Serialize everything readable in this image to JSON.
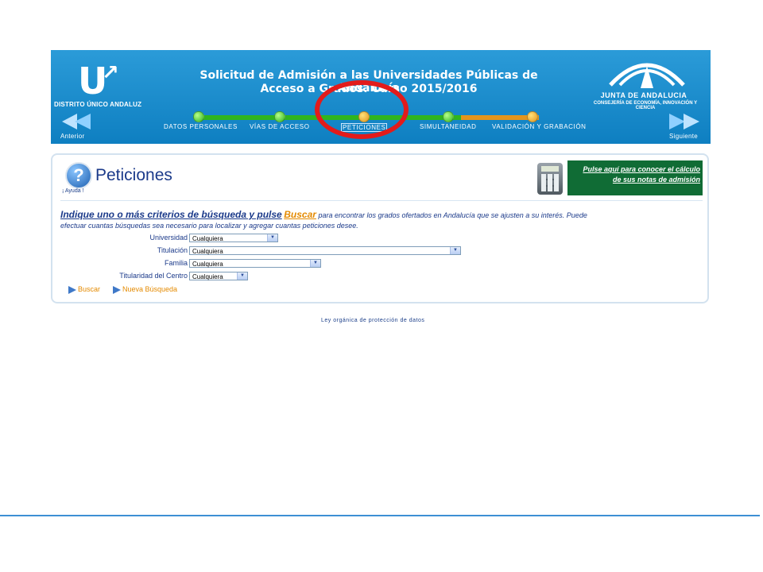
{
  "header": {
    "logo_text": "U",
    "district_label": "DISTRITO ÚNICO ANDALUZ",
    "title_line1": "Solicitud de Admisión a las Universidades Públicas de Andalucía",
    "title_line2": "Acceso a Grados. Curso 2015/2016",
    "junta_name": "JUNTA DE ANDALUCIA",
    "consejeria": "CONSEJERÍA DE ECONOMÍA, INNOVACIÓN Y CIENCIA",
    "prev_label": "Anterior",
    "next_label": "Siguiente",
    "steps": [
      {
        "label": "DATOS PERSONALES",
        "status": "done"
      },
      {
        "label": "VÍAS DE ACCESO",
        "status": "done"
      },
      {
        "label": "PETICIONES",
        "status": "current"
      },
      {
        "label": "SIMULTANEIDAD",
        "status": "done"
      },
      {
        "label": "VALIDACIÓN Y GRABACIÓN",
        "status": "pending"
      }
    ]
  },
  "colors": {
    "header_blue": "#0e7fc1",
    "step_green": "#2fb51e",
    "step_orange": "#e3951c",
    "highlight_red": "#e21b1b",
    "link_orange": "#e48a00",
    "text_blue": "#1b3a8a",
    "grade_box_green": "#106c35"
  },
  "panel": {
    "help_label": "¡ Ayuda !",
    "title": "Peticiones",
    "grade_link_line1": "Pulse aquí para conocer el cálculo",
    "grade_link_line2": "de sus notas de admisión",
    "instruction_lead": "Indique uno o más criterios de búsqueda y pulse",
    "instruction_buscar": "Buscar",
    "instruction_rest": "para encontrar los grados ofertados en Andalucía que se ajusten a su interés. Puede",
    "instruction_line2": "efectuar cuantas búsquedas sea necesario para localizar y agregar cuantas peticiones desee.",
    "filters": [
      {
        "label": "Universidad",
        "value": "Cualquiera"
      },
      {
        "label": "Titulación",
        "value": "Cualquiera"
      },
      {
        "label": "Familia",
        "value": "Cualquiera"
      },
      {
        "label": "Titularidad del Centro",
        "value": "Cualquiera"
      }
    ],
    "buscar_label": "Buscar",
    "nueva_busqueda_label": "Nueva Búsqueda"
  },
  "footer": {
    "link": "Ley orgánica de protección de datos"
  }
}
